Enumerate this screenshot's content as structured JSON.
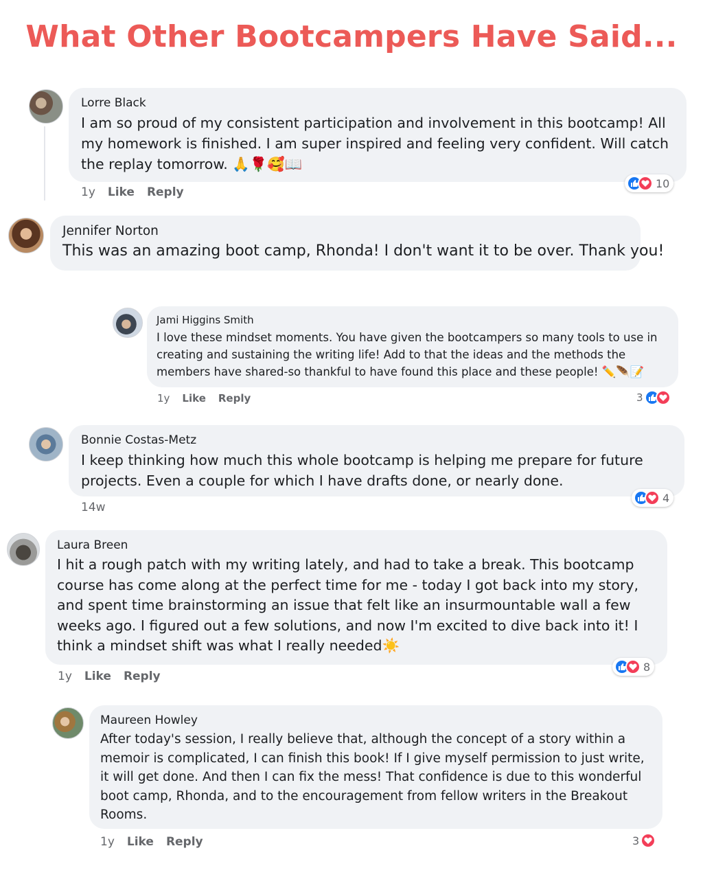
{
  "headline": "What Other Bootcampers Have Said...",
  "actions": {
    "like": "Like",
    "reply": "Reply"
  },
  "comments": [
    {
      "author": "Lorre Black",
      "text": "I am so proud of my consistent participation and involvement in this bootcamp! All my homework is finished. I am super inspired and feeling very confident. Will catch the replay tomorrow. 🙏🌹🥰📖",
      "time": "1y",
      "reactions": "10",
      "reaction_icons": [
        "like-icon",
        "love-icon"
      ]
    },
    {
      "author": "Jennifer Norton",
      "text": "This was an amazing boot camp, Rhonda! I don't want it to be over. Thank you!"
    },
    {
      "author": "Jami Higgins Smith",
      "text": "I love these mindset moments. You have given the bootcampers so many tools to use in creating and sustaining the writing life! Add to that the ideas and the methods the members have shared-so thankful to have found this place and these people! ✏️🪶📝",
      "time": "1y",
      "reactions": "3",
      "reaction_icons": [
        "like-icon",
        "love-icon"
      ]
    },
    {
      "author": "Bonnie Costas-Metz",
      "text": "I keep thinking how much this whole bootcamp is helping me prepare for future projects. Even a couple for which I have drafts done, or nearly done.",
      "time": "14w",
      "reactions": "4",
      "reaction_icons": [
        "like-icon",
        "love-icon"
      ]
    },
    {
      "author": "Laura Breen",
      "text": "I hit a rough patch with my writing lately, and had to take a break. This bootcamp course has come along at the perfect time for me - today I got back into my story, and spent time brainstorming an issue that felt like an insurmountable wall a few weeks ago. I figured out a few solutions, and now I'm excited to dive back into it! I think a mindset shift was what I really needed☀️",
      "time": "1y",
      "reactions": "8",
      "reaction_icons": [
        "like-icon",
        "love-icon"
      ]
    },
    {
      "author": "Maureen Howley",
      "text": "After today's session, I really believe that, although the concept of a story within a memoir is complicated, I can finish this book! If I give myself permission to just write, it will get done. And then I can fix the mess! That confidence is due to this wonderful boot camp, Rhonda, and to the encouragement from fellow writers in the Breakout Rooms.",
      "time": "1y",
      "reactions": "3",
      "reaction_icons": [
        "love-icon"
      ]
    }
  ]
}
